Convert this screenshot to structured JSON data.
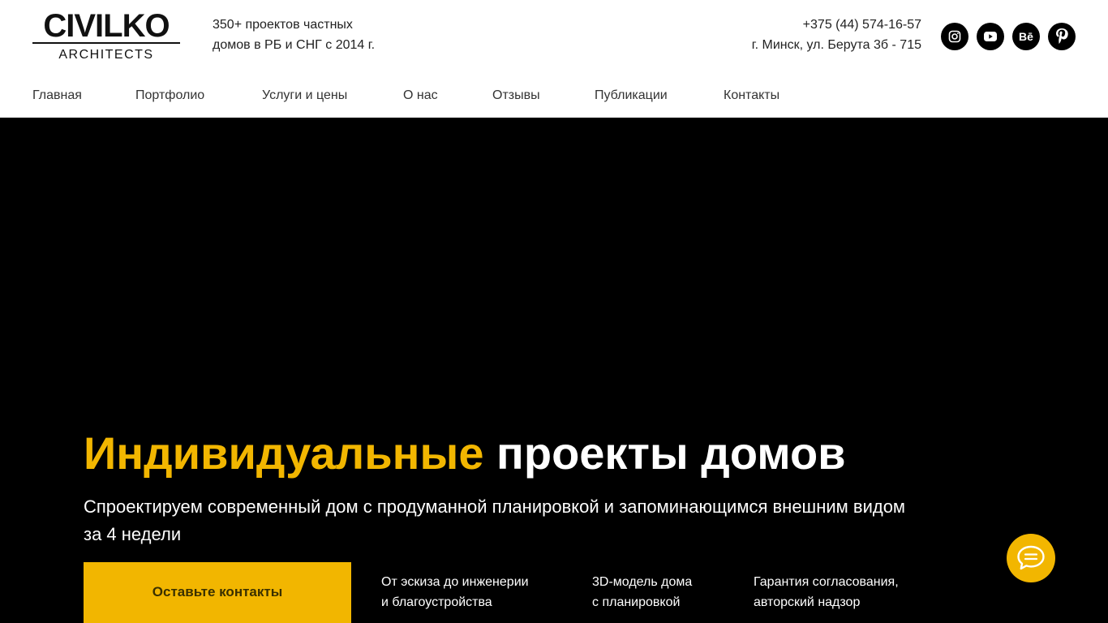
{
  "logo": {
    "main": "CIVILKO",
    "sub": "ARCHITECTS"
  },
  "tagline": {
    "line1": "350+ проектов частных",
    "line2": "домов в РБ и СНГ с 2014 г."
  },
  "contacts": {
    "phone": "+375 (44) 574-16-57",
    "address": "г. Минск, ул. Берута 3б - 715"
  },
  "socials": [
    {
      "name": "instagram-icon"
    },
    {
      "name": "youtube-icon"
    },
    {
      "name": "behance-icon",
      "label": "Bē"
    },
    {
      "name": "pinterest-icon"
    }
  ],
  "nav": {
    "items": [
      {
        "label": "Главная"
      },
      {
        "label": "Портфолио"
      },
      {
        "label": "Услуги и цены"
      },
      {
        "label": "О нас"
      },
      {
        "label": "Отзывы"
      },
      {
        "label": "Публикации"
      },
      {
        "label": "Контакты"
      }
    ]
  },
  "hero": {
    "title_accent": "Индивидуальные",
    "title_rest": "проекты домов",
    "subtitle": "Спроектируем современный дом с продуманной планировкой и запоминающимся внешним видом за 4 недели",
    "cta_label": "Оставьте контакты",
    "features": [
      {
        "line1": "От эскиза до инженерии",
        "line2": "и благоустройства"
      },
      {
        "line1": "3D-модель дома",
        "line2": "с планировкой"
      },
      {
        "line1": "Гарантия согласования,",
        "line2": "авторский надзор"
      }
    ]
  },
  "colors": {
    "accent": "#f2b600",
    "hero_bg": "#000000",
    "header_bg": "#ffffff"
  }
}
